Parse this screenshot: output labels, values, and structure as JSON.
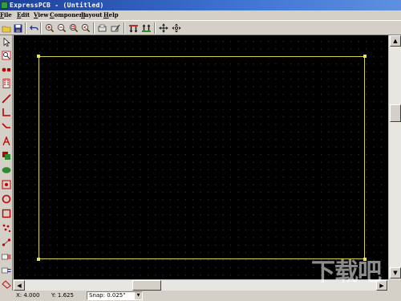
{
  "window": {
    "title": "ExpressPCB - (Untitled)"
  },
  "menu": {
    "items": [
      {
        "label": "File",
        "accel": "F",
        "rest": "ile"
      },
      {
        "label": "Edit",
        "accel": "E",
        "rest": "dit"
      },
      {
        "label": "View",
        "accel": "V",
        "rest": "iew"
      },
      {
        "label": "Component",
        "accel": "C",
        "rest": "omponent"
      },
      {
        "label": "Layout",
        "accel": "L",
        "rest": "ayout"
      },
      {
        "label": "Help",
        "accel": "H",
        "rest": "elp"
      }
    ]
  },
  "toolbar": {
    "open_icon": "folder-open-icon",
    "save_icon": "floppy-disk-icon",
    "undo_icon": "undo-icon",
    "zoom_in_icon": "zoom-in-icon",
    "zoom_out_icon": "zoom-out-icon",
    "zoom_fit_icon": "zoom-fit-icon",
    "zoom_prev_icon": "zoom-previous-icon",
    "place_part_icon": "place-component-icon",
    "edit_part_icon": "edit-component-icon",
    "top_layer_icon": "top-layer-icon",
    "bottom_layer_icon": "bottom-layer-icon",
    "move_icon": "move-arrows-icon",
    "pan_icon": "pan-arrows-icon"
  },
  "status": {
    "x_label": "X: 4.000",
    "y_label": "Y: 1.625",
    "snap_label": "Snap: 0.025\""
  },
  "watermark": {
    "text": "下载吧"
  },
  "colors": {
    "canvas_bg": "#000000",
    "grid_dot": "#3d3d3d",
    "board_outline": "#d8d04a",
    "titlebar": "#1c3f9a"
  }
}
